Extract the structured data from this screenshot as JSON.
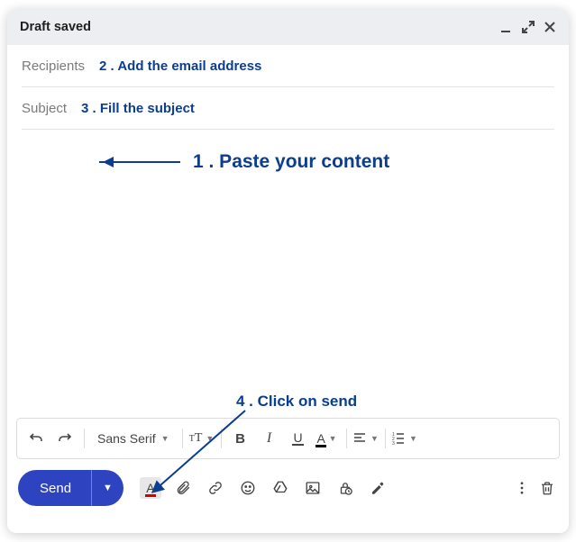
{
  "header": {
    "title": "Draft saved"
  },
  "fields": {
    "recipients_label": "Recipients",
    "subject_label": "Subject"
  },
  "annotations": {
    "step1": "1 . Paste your content",
    "step2": "2 . Add the email address",
    "step3": "3 . Fill the subject",
    "step4": "4 . Click on send"
  },
  "format_bar": {
    "font_family": "Sans Serif"
  },
  "actions": {
    "send_label": "Send"
  },
  "colors": {
    "accent": "#2e43c0",
    "annotation": "#0b3d91"
  }
}
